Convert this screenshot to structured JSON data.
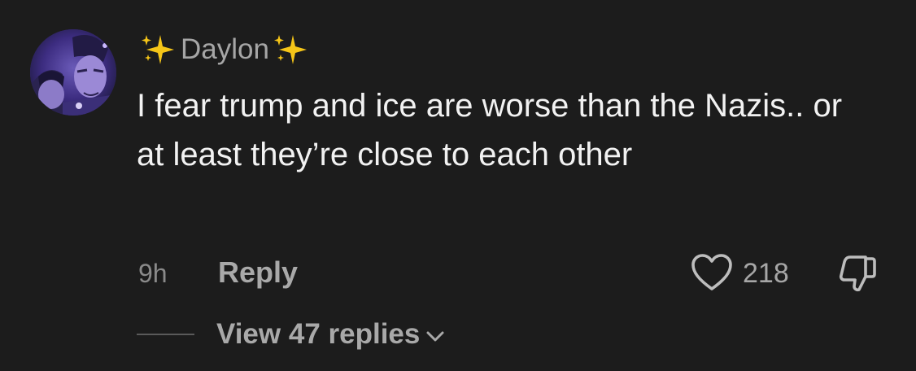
{
  "comment": {
    "avatar_icon": "anime-character-avatar",
    "username": "Daylon",
    "username_decoration_icon": "sparkles-emoji",
    "text": "I fear trump and ice are worse than the Nazis.. or at least they’re close to each other",
    "timestamp": "9h",
    "reply_label": "Reply",
    "like_icon": "heart-outline-icon",
    "like_count": "218",
    "dislike_icon": "thumbs-down-outline-icon",
    "view_replies_label": "View 47 replies",
    "view_replies_icon": "chevron-down-icon"
  },
  "colors": {
    "background": "#1c1c1c",
    "text_primary": "#f2f2f2",
    "text_secondary": "#a6a6a6",
    "sparkle": "#f5c518"
  }
}
